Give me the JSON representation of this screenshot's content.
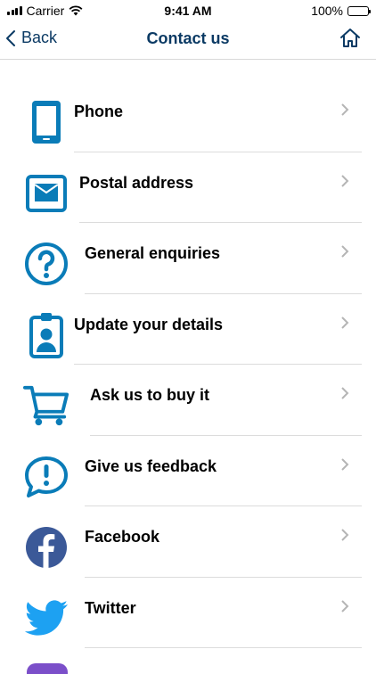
{
  "status": {
    "carrier": "Carrier",
    "time": "9:41 AM",
    "battery": "100%"
  },
  "nav": {
    "back_label": "Back",
    "title": "Contact us"
  },
  "colors": {
    "brand_blue": "#0a7cb8",
    "nav_text": "#0b3a64",
    "facebook": "#3b5998",
    "twitter": "#1da1f2"
  },
  "items": [
    {
      "label": "Phone",
      "icon": "phone-icon"
    },
    {
      "label": "Postal address",
      "icon": "mail-icon"
    },
    {
      "label": "General enquiries",
      "icon": "question-icon"
    },
    {
      "label": "Update your details",
      "icon": "id-badge-icon"
    },
    {
      "label": "Ask us to buy it",
      "icon": "cart-icon"
    },
    {
      "label": "Give us feedback",
      "icon": "feedback-icon"
    },
    {
      "label": "Facebook",
      "icon": "facebook-icon"
    },
    {
      "label": "Twitter",
      "icon": "twitter-icon"
    }
  ]
}
